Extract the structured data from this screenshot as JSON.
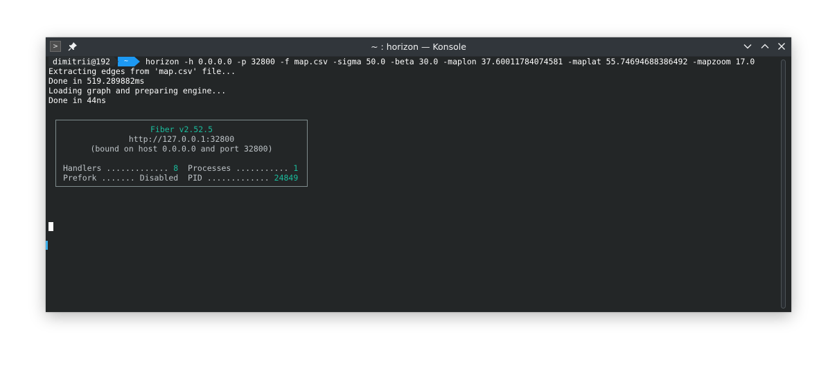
{
  "window": {
    "title": "~ : horizon — Konsole"
  },
  "titlebar": {
    "app_icon_glyph": ">",
    "icons": [
      "terminal-icon",
      "pin-icon",
      "minimize-icon",
      "maximize-icon",
      "close-icon"
    ]
  },
  "terminal": {
    "prompt": {
      "user_host": "dimitrii@192",
      "directory": "~",
      "command": "horizon -h 0.0.0.0 -p 32800 -f map.csv -sigma 50.0 -beta 30.0 -maplon 37.60011784074581 -maplat 55.74694688386492 -mapzoom 17.0"
    },
    "output_lines": [
      "Extracting edges from 'map.csv' file...",
      "Done in 519.289882ms",
      "Loading graph and preparing engine...",
      "Done in 44ns"
    ],
    "fiber_banner": {
      "title": "Fiber v2.52.5",
      "url": "http://127.0.0.1:32800",
      "bound": "(bound on host 0.0.0.0 and port 32800)",
      "handlers_label": "Handlers ............. ",
      "handlers_value": "8",
      "processes_label": "  Processes ........... ",
      "processes_value": "1",
      "prefork_label": "Prefork ....... Disabled",
      "pid_label": "  PID ............. ",
      "pid_value": "24849"
    }
  },
  "colors": {
    "background": "#232627",
    "titlebar": "#31363b",
    "text": "#fcfcfc",
    "accent_blue": "#1d99f3",
    "fiber_green": "#1abc9c",
    "banner_text": "#bdc3c7"
  }
}
